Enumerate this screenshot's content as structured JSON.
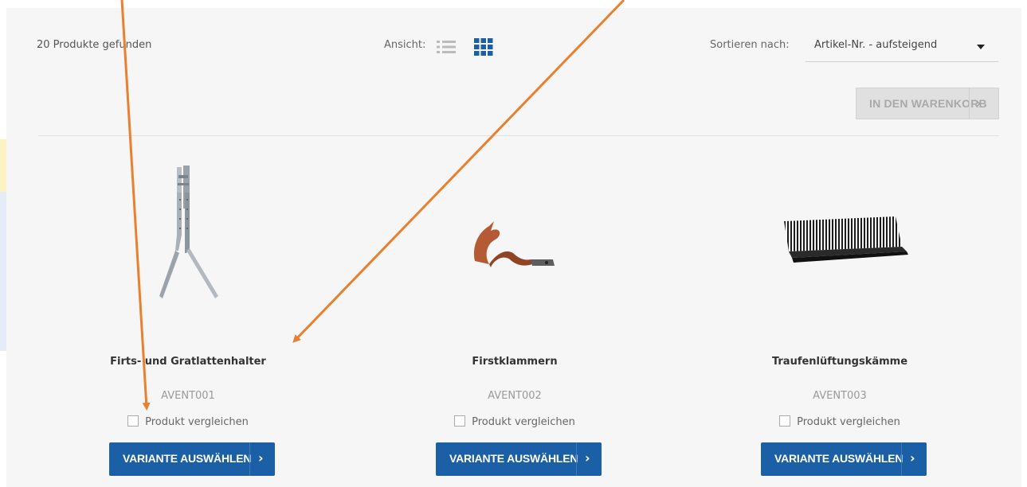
{
  "toolbar": {
    "results_count": "20 Produkte gefunden",
    "view_label": "Ansicht:",
    "view_icons": [
      "list-view-icon",
      "grid-view-icon"
    ],
    "active_view": "grid",
    "sort_label": "Sortieren nach:",
    "sort_value": "Artikel-Nr. - aufsteigend",
    "add_to_cart_label": "IN DEN WARENKORB",
    "add_to_cart_arrow": "›"
  },
  "products": [
    {
      "name": "Firts- und Gratlattenhalter",
      "sku": "AVENT001",
      "compare_label": "Produkt vergleichen",
      "button_label": "VARIANTE AUSWÄHLEN",
      "button_arrow": "›"
    },
    {
      "name": "Firstklammern",
      "sku": "AVENT002",
      "compare_label": "Produkt vergleichen",
      "button_label": "VARIANTE AUSWÄHLEN",
      "button_arrow": "›"
    },
    {
      "name": "Traufenlüftungskämme",
      "sku": "AVENT003",
      "compare_label": "Produkt vergleichen",
      "button_label": "VARIANTE AUSWÄHLEN",
      "button_arrow": "›"
    }
  ],
  "colors": {
    "primary_button": "#1b5fa6",
    "annotation_arrow": "#e8802f",
    "disabled_button": "#e0e0e0"
  }
}
